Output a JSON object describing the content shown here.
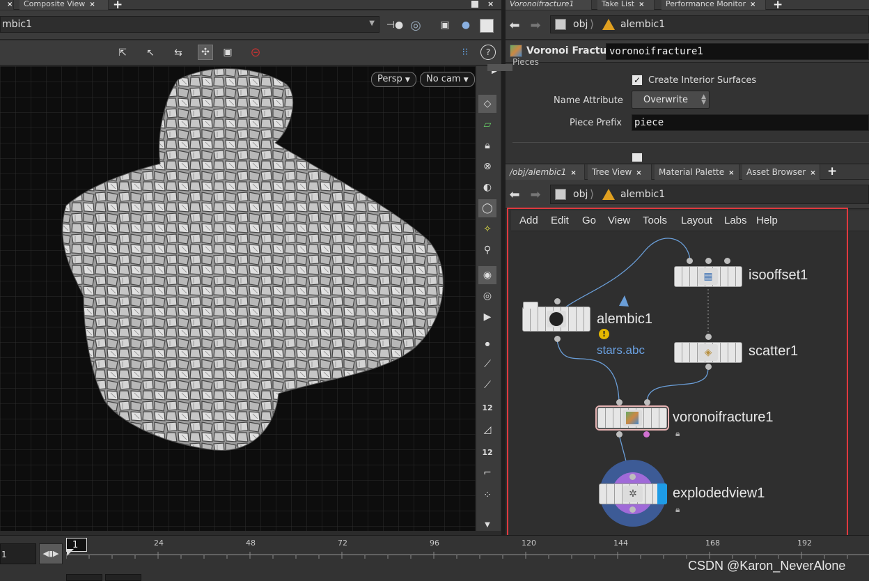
{
  "left_tabs": {
    "tab1": "Composite View"
  },
  "viewport": {
    "object_path": "mbic1",
    "persp_label": "Persp",
    "cam_label": "No cam"
  },
  "param_panel": {
    "tabs": [
      "Voronoifracture1",
      "Take List",
      "Performance Monitor"
    ],
    "path_obj": "obj",
    "path_node": "alembic1",
    "node_type": "Voronoi Fracture",
    "node_name": "voronoifracture1",
    "section_label": "Pieces",
    "create_interior_label": "Create Interior Surfaces",
    "name_attribute_label": "Name Attribute",
    "name_attribute_value": "Overwrite",
    "piece_prefix_label": "Piece Prefix",
    "piece_prefix_value": "piece"
  },
  "network_panel": {
    "tabs": [
      "/obj/alembic1",
      "Tree View",
      "Material Palette",
      "Asset Browser"
    ],
    "path_obj": "obj",
    "path_node": "alembic1",
    "menu": [
      "Add",
      "Edit",
      "Go",
      "View",
      "Tools",
      "Layout",
      "Labs",
      "Help"
    ],
    "nodes": {
      "isooffset": "isooffset1",
      "alembic": "alembic1",
      "alembic_file": "stars.abc",
      "scatter": "scatter1",
      "voronoi": "voronoifracture1",
      "explodedview": "explodedview1"
    }
  },
  "timeline": {
    "current_frame": "1",
    "frame_field": "1",
    "ticks": [
      "24",
      "48",
      "72",
      "96",
      "120",
      "144",
      "168",
      "192"
    ]
  },
  "watermark": "CSDN @Karon_NeverAlone"
}
